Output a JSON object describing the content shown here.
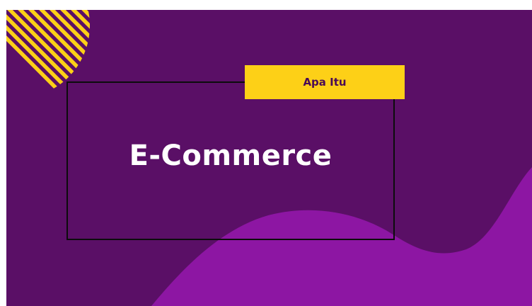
{
  "slide": {
    "tag_label": "Apa Itu",
    "title": "E-Commerce"
  },
  "colors": {
    "background": "#5a0f66",
    "wave": "#8d16a3",
    "accent_yellow": "#fdd017",
    "frame": "#0c0c0c",
    "title_text": "#ffffff",
    "tag_text": "#4a0b55"
  },
  "decor": {
    "corner_pattern": "diagonal-stripes-circle",
    "bottom_shape": "purple-wave"
  }
}
